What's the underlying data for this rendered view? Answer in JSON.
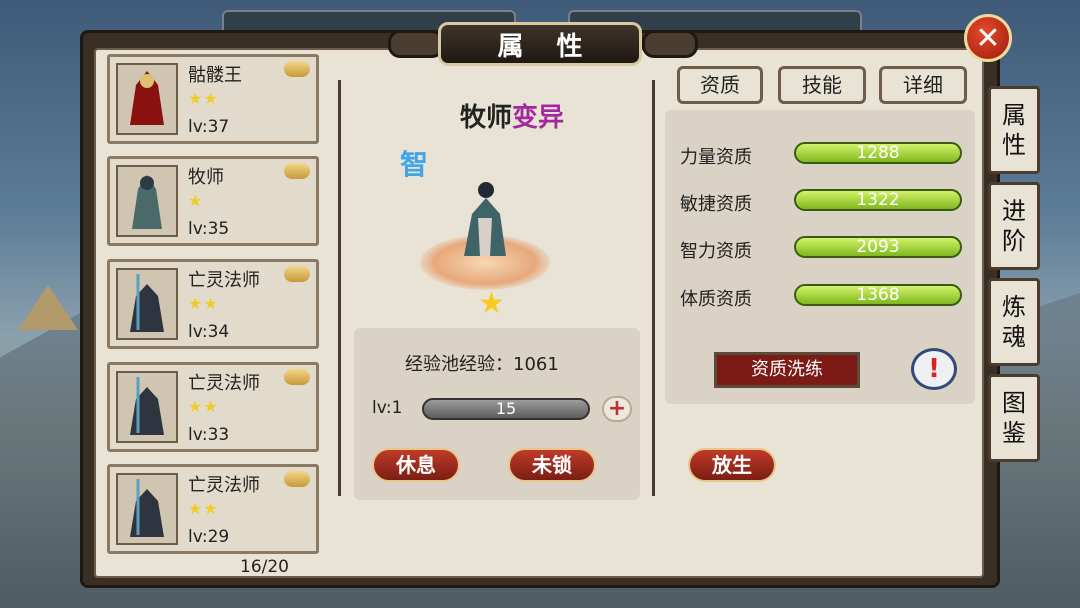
{
  "window": {
    "title": "属 性"
  },
  "heroes": [
    {
      "name": "骷髅王",
      "stars": "★★",
      "level": "lv:37"
    },
    {
      "name": "牧师",
      "stars": "★",
      "level": "lv:35"
    },
    {
      "name": "亡灵法师",
      "stars": "★★",
      "level": "lv:34"
    },
    {
      "name": "亡灵法师",
      "stars": "★★",
      "level": "lv:33"
    },
    {
      "name": "亡灵法师",
      "stars": "★★",
      "level": "lv:29"
    }
  ],
  "hero_count": "16/20",
  "detail": {
    "name": "牧师",
    "mutation": "变异",
    "attribute_badge": "智",
    "star": "★",
    "exp_pool_label": "经验池经验：1061",
    "level_label": "lv:1",
    "exp_value": "15",
    "rest_button": "休息",
    "lock_button": "未锁",
    "release_button": "放生"
  },
  "right_tabs": [
    "资质",
    "技能",
    "详细"
  ],
  "stats": [
    {
      "label": "力量资质",
      "value": "1288"
    },
    {
      "label": "敏捷资质",
      "value": "1322"
    },
    {
      "label": "智力资质",
      "value": "2093"
    },
    {
      "label": "体质资质",
      "value": "1368"
    }
  ],
  "wash_button": "资质洗练",
  "warn_icon": "!",
  "side_tabs": [
    {
      "line1": "属",
      "line2": "性"
    },
    {
      "line1": "进",
      "line2": "阶"
    },
    {
      "line1": "炼",
      "line2": "魂"
    },
    {
      "line1": "图",
      "line2": "鉴"
    }
  ],
  "colors": {
    "stat_bar": "#a8d63a",
    "button_red": "#9e2a1c",
    "mutation": "#a328a0",
    "badge_blue": "#3fa7e8"
  }
}
